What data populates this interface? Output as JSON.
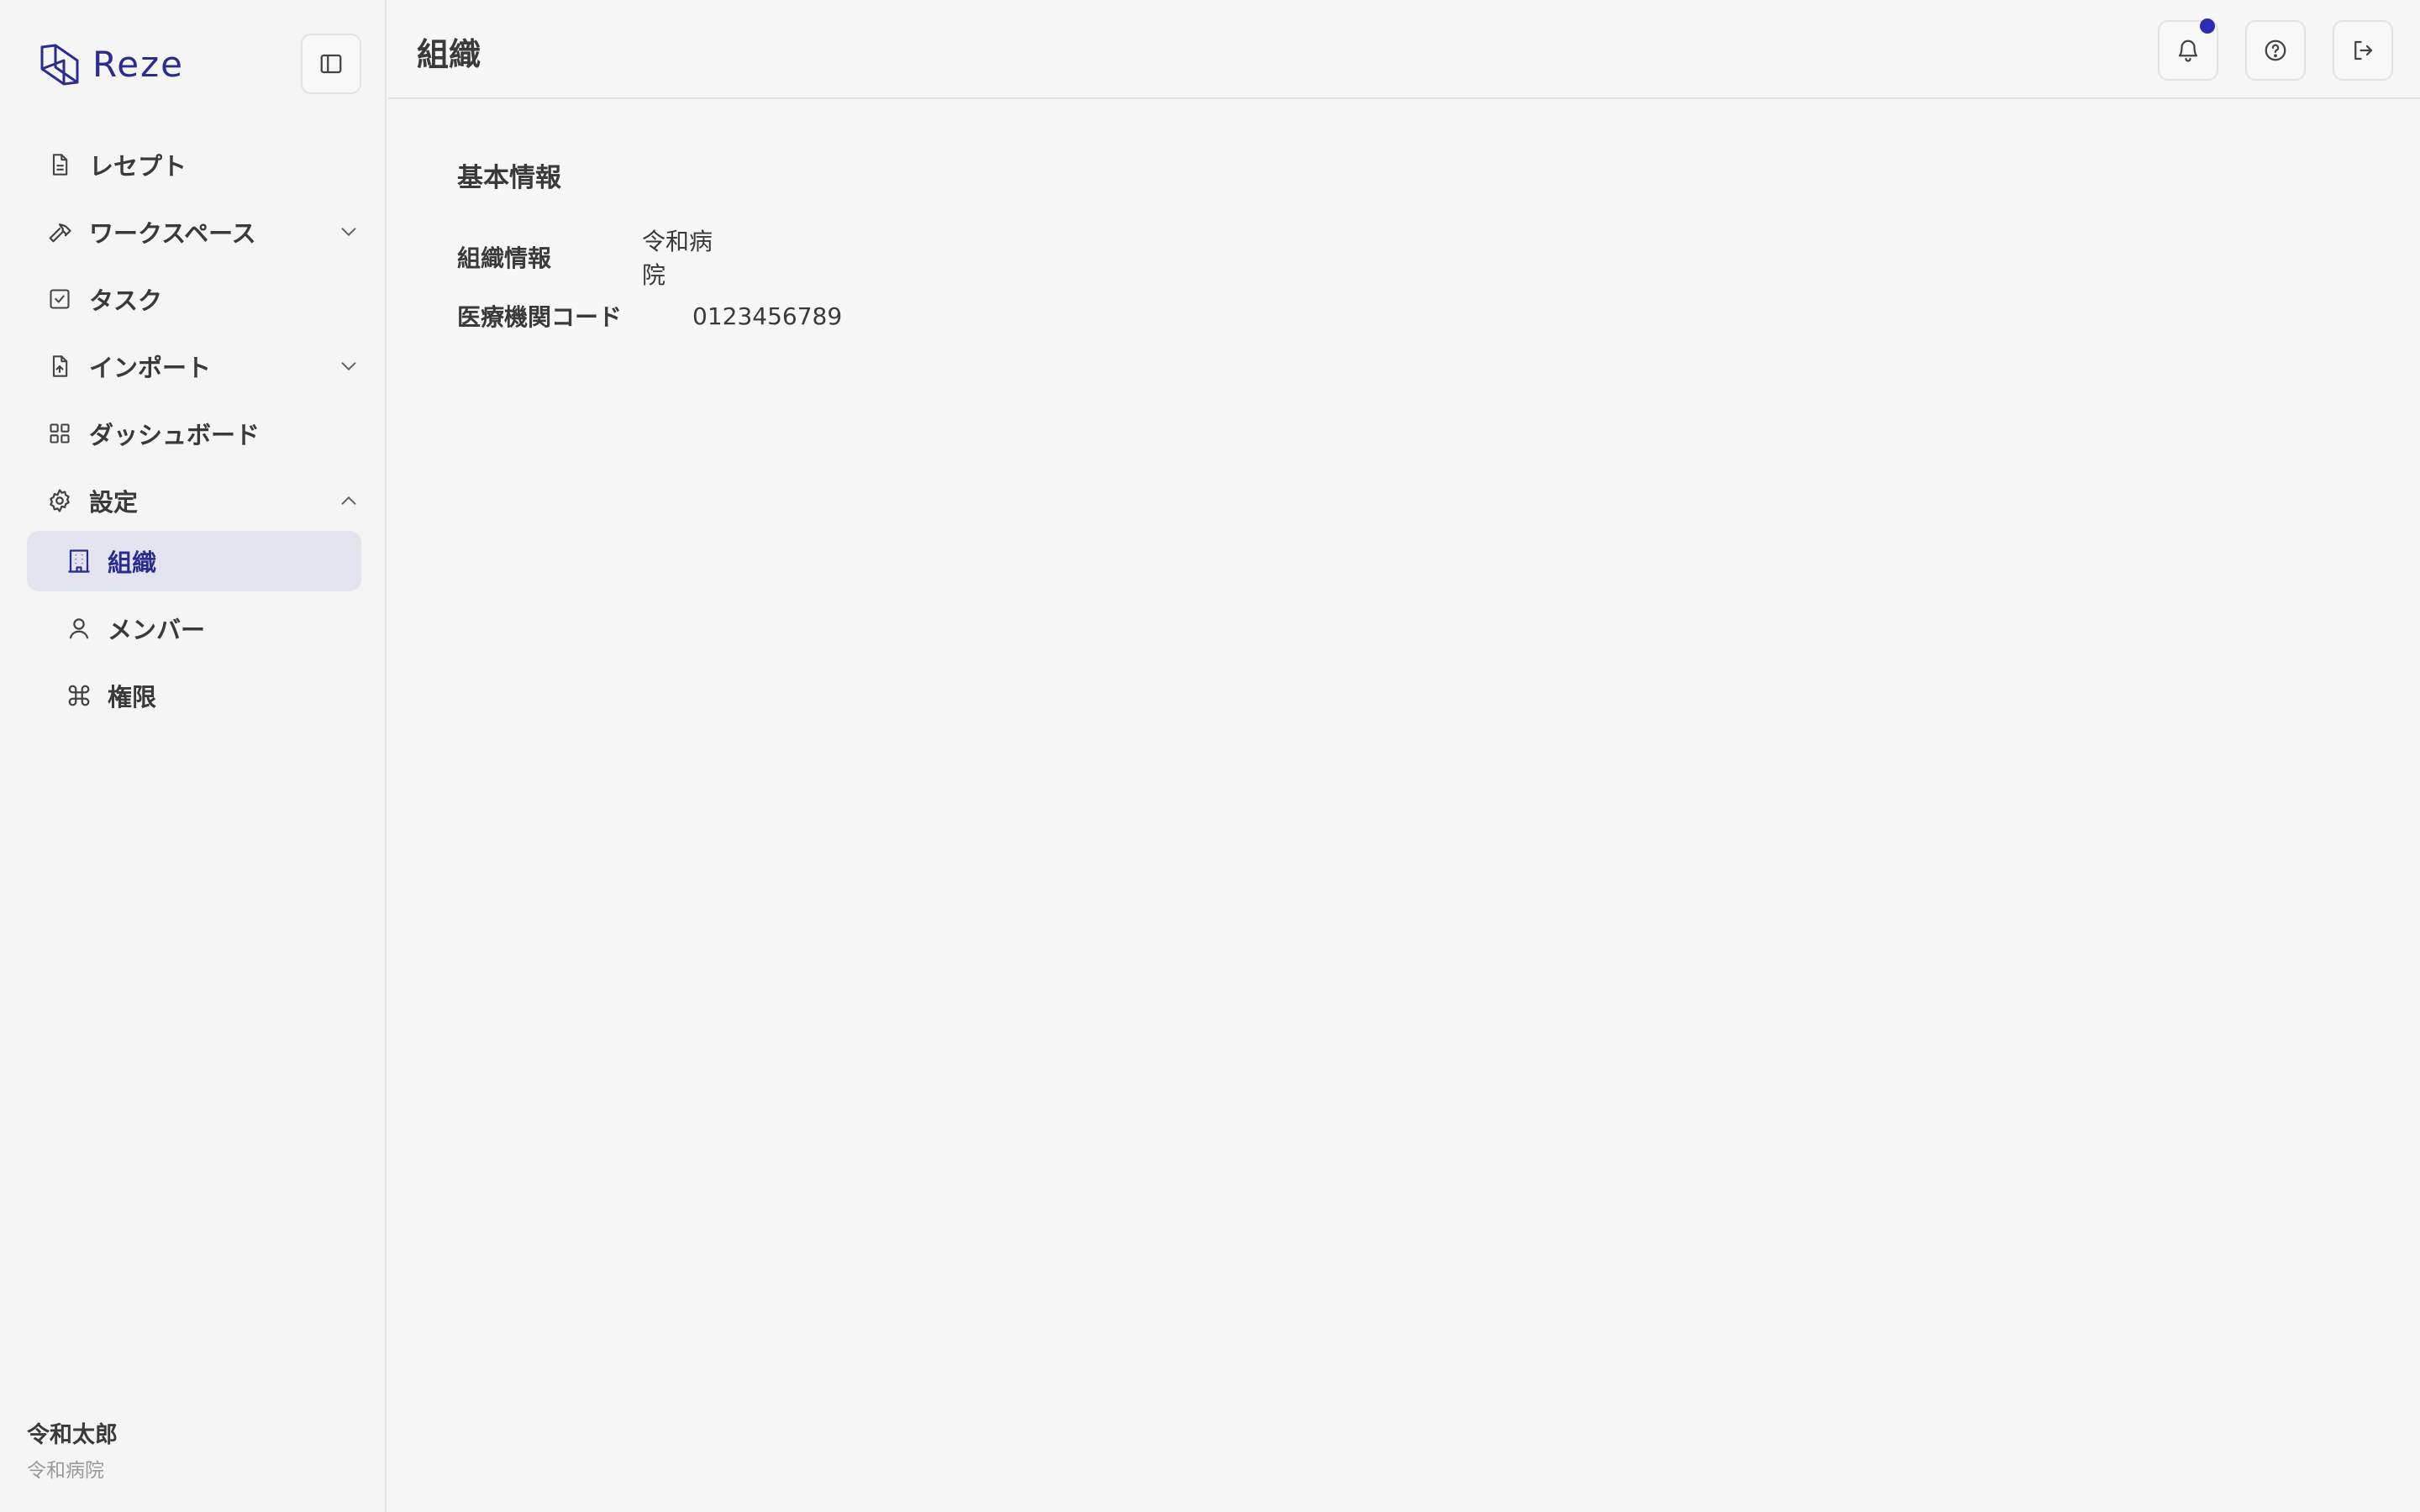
{
  "brand": {
    "name": "Reze",
    "accent": "#2a2d8f"
  },
  "header": {
    "title": "組織"
  },
  "sidebar": {
    "items": [
      {
        "label": "レセプト",
        "icon": "document-icon"
      },
      {
        "label": "ワークスペース",
        "icon": "hammer-icon",
        "expandable": true,
        "expanded": false
      },
      {
        "label": "タスク",
        "icon": "checkbox-icon"
      },
      {
        "label": "インポート",
        "icon": "file-upload-icon",
        "expandable": true,
        "expanded": false
      },
      {
        "label": "ダッシュボード",
        "icon": "grid-icon"
      },
      {
        "label": "設定",
        "icon": "gear-icon",
        "expandable": true,
        "expanded": true
      }
    ],
    "subitems": [
      {
        "label": "組織",
        "icon": "building-icon",
        "active": true
      },
      {
        "label": "メンバー",
        "icon": "user-icon",
        "active": false
      },
      {
        "label": "権限",
        "icon": "command-icon",
        "active": false
      }
    ]
  },
  "user": {
    "name": "令和太郎",
    "org": "令和病院"
  },
  "main": {
    "section_title": "基本情報",
    "fields": [
      {
        "label": "組織情報",
        "value": "令和病院"
      },
      {
        "label": "医療機関コード",
        "value": "0123456789"
      }
    ]
  },
  "notifications": {
    "has_unread": true,
    "dot_color": "#2c2cb0"
  }
}
